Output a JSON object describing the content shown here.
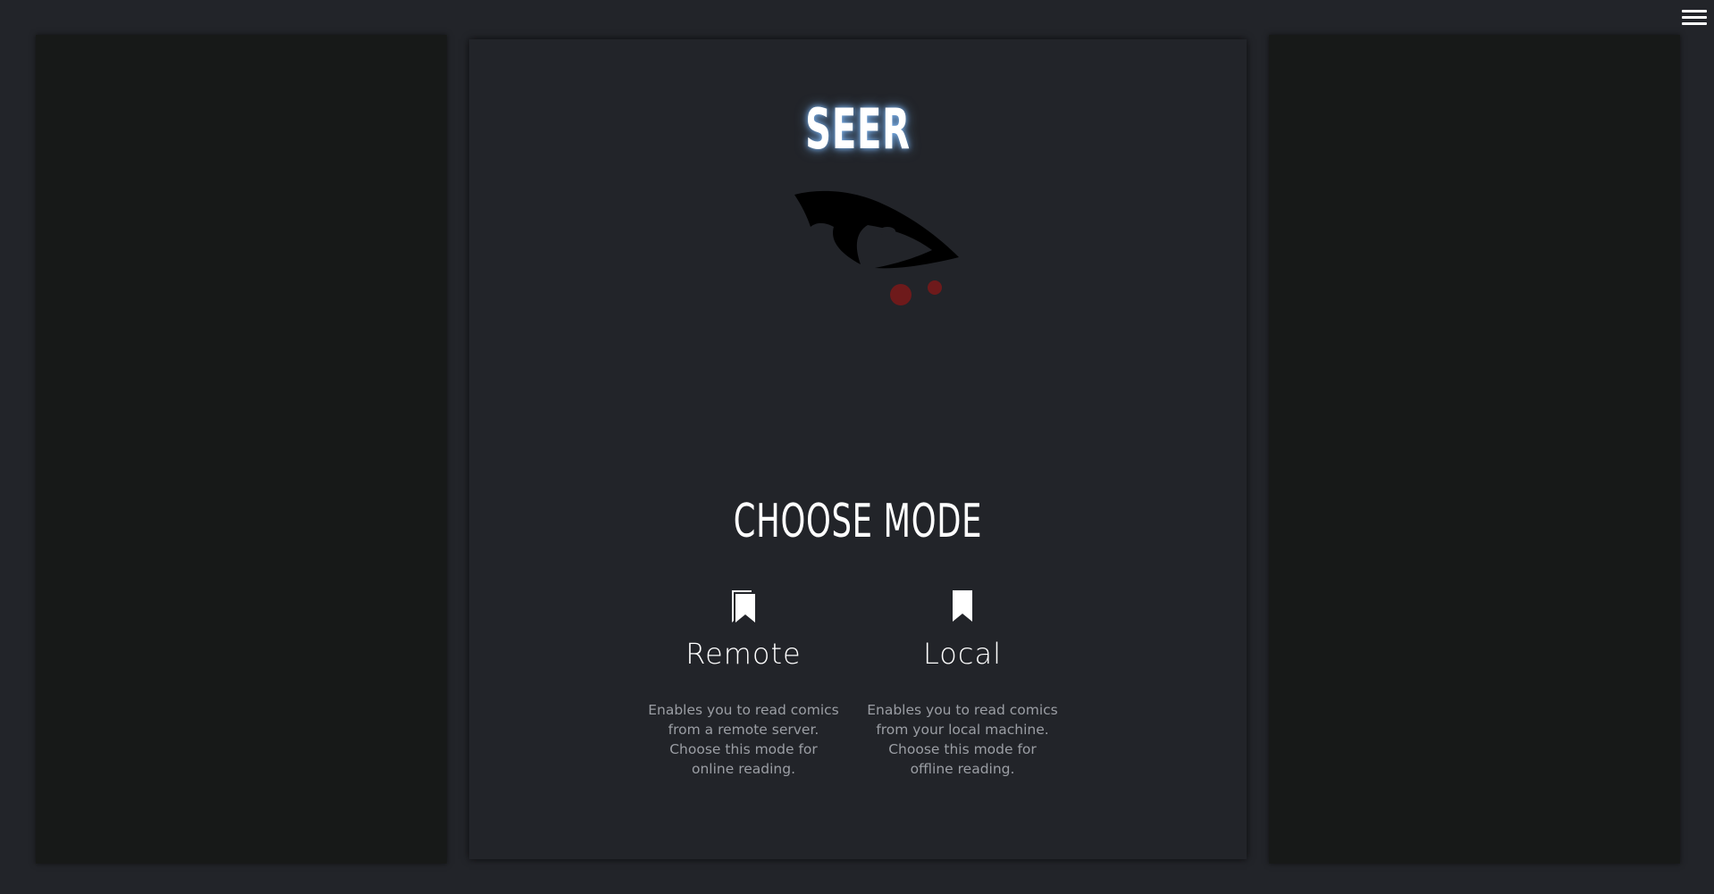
{
  "app": {
    "title": "SEER"
  },
  "header": {
    "menu_icon": "hamburger-menu-icon"
  },
  "main": {
    "heading": "CHOOSE MODE",
    "modes": [
      {
        "label": "Remote",
        "icon": "stacked-bookmark-icon",
        "description": "Enables you to read comics from a remote server. Choose this mode for online reading."
      },
      {
        "label": "Local",
        "icon": "bookmark-icon",
        "description": "Enables you to read comics from your local machine. Choose this mode for offline reading."
      }
    ]
  },
  "colors": {
    "background": "#222429",
    "side_panel": "#171918",
    "title_glow": "#82beff",
    "text": "#ffffff",
    "muted_text": "#9b9ea4",
    "logo_dots": "#6e1a1b"
  }
}
